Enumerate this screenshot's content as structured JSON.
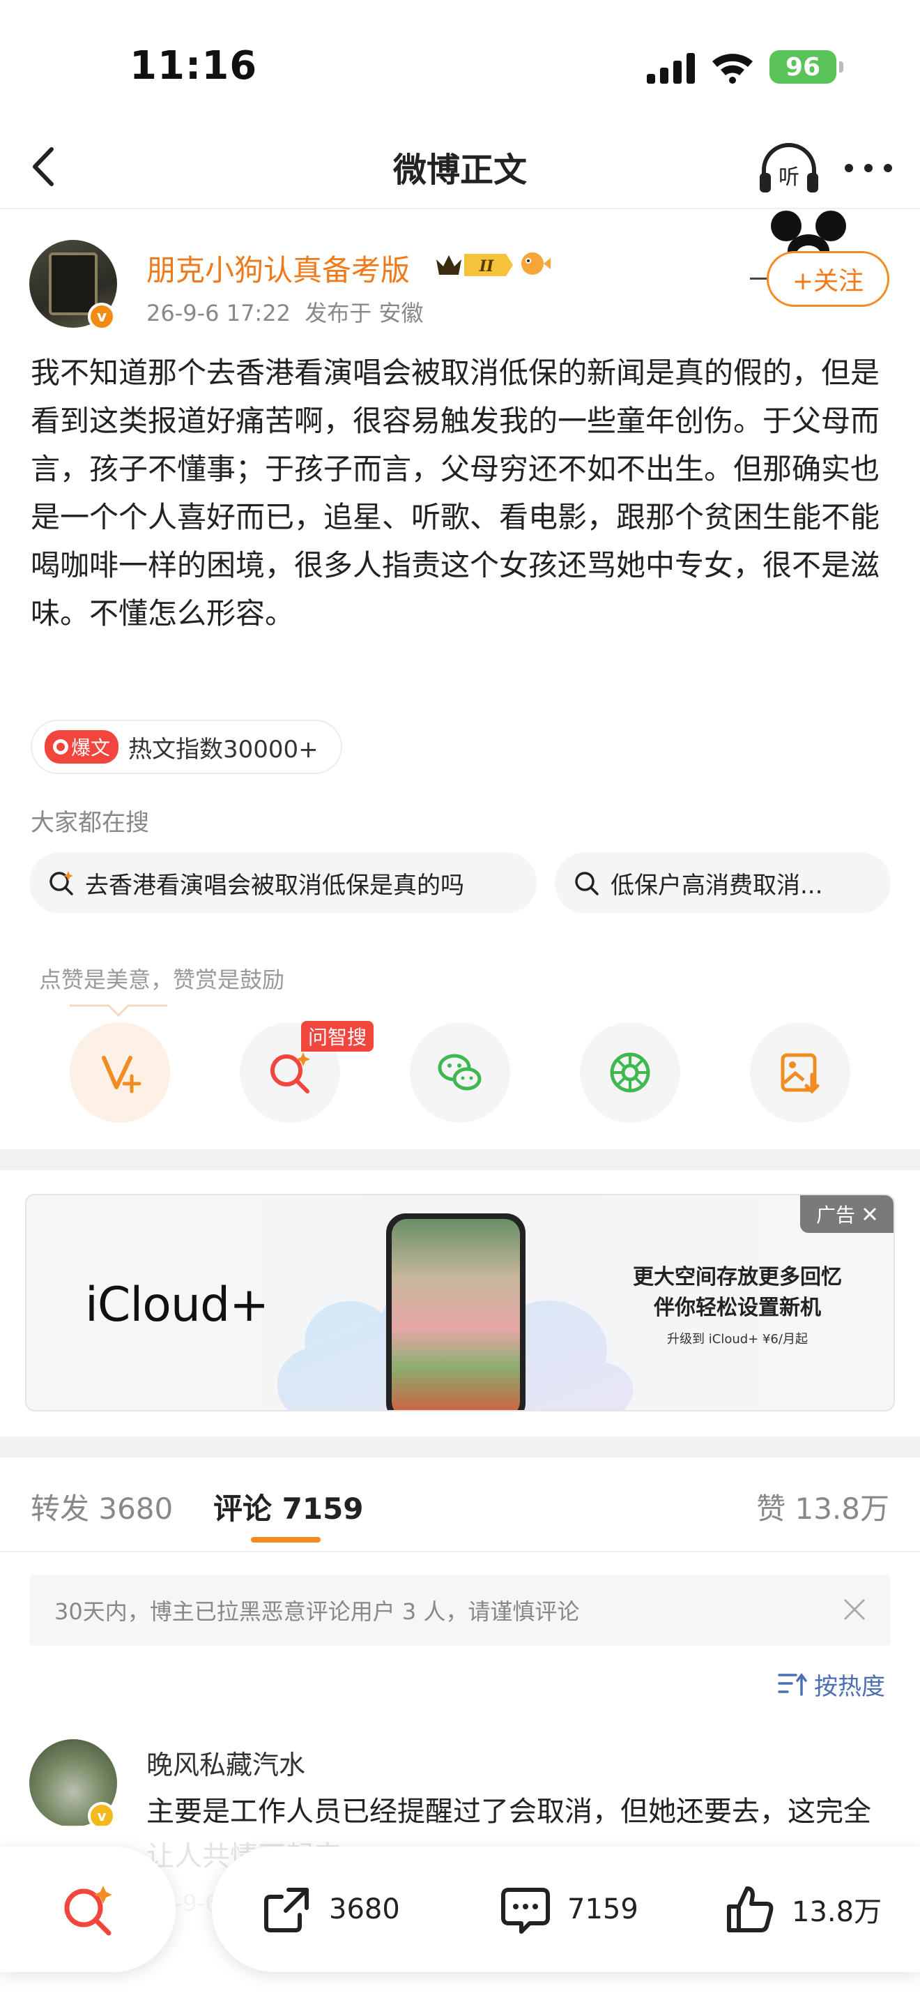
{
  "status_bar": {
    "time": "11:16",
    "battery": "96"
  },
  "nav": {
    "title": "微博正文",
    "listen_label": "听"
  },
  "author": {
    "name": "朋克小狗认真备考版",
    "vip_level": "II",
    "post_time": "26-9-6 17:22",
    "location": "发布于 安徽",
    "verify_mark": "v",
    "follow_label": "+关注"
  },
  "post": {
    "text": "我不知道那个去香港看演唱会被取消低保的新闻是真的假的，但是看到这类报道好痛苦啊，很容易触发我的一些童年创伤。于父母而言，孩子不懂事；于孩子而言，父母穷还不如不出生。但那确实也是一个个人喜好而已，追星、听歌、看电影，跟那个贫困生能不能喝咖啡一样的困境，很多人指责这个女孩还骂她中专女，很不是滋味。不懂怎么形容。"
  },
  "hot": {
    "badge": "爆文",
    "label": "热文指数30000+"
  },
  "search": {
    "title": "大家都在搜",
    "chips": [
      "去香港看演唱会被取消低保是真的吗",
      "低保户高消费取消..."
    ]
  },
  "reward": {
    "tip": "点赞是美意，赞赏是鼓励",
    "ask_badge": "问智搜",
    "actions": [
      "reward-icon",
      "ai-search-icon",
      "wechat-icon",
      "moments-icon",
      "save-image-icon"
    ]
  },
  "ad": {
    "brand": "iCloud+",
    "headline_1": "更大空间存放更多回忆",
    "headline_2": "伴你轻松设置新机",
    "sub": "升级到 iCloud+ ¥6/月起",
    "label": "广告"
  },
  "tabs": {
    "repost": "转发 3680",
    "comments": "评论 7159",
    "likes": "赞 13.8万"
  },
  "notice": {
    "text": "30天内，博主已拉黑恶意评论用户 3 人，请谨慎评论"
  },
  "sort": {
    "label": "按热度"
  },
  "comment": {
    "name": "晚风私藏汽水",
    "text": "主要是工作人员已经提醒过了会取消，但她还要去，这完全让人共情不起来",
    "date": "26-9-6"
  },
  "bottom": {
    "repost_count": "3680",
    "comment_count": "7159",
    "like_count": "13.8万"
  },
  "colors": {
    "accent": "#f07a1b",
    "hot_red": "#f2453d",
    "link_blue": "#4a6fb5"
  }
}
